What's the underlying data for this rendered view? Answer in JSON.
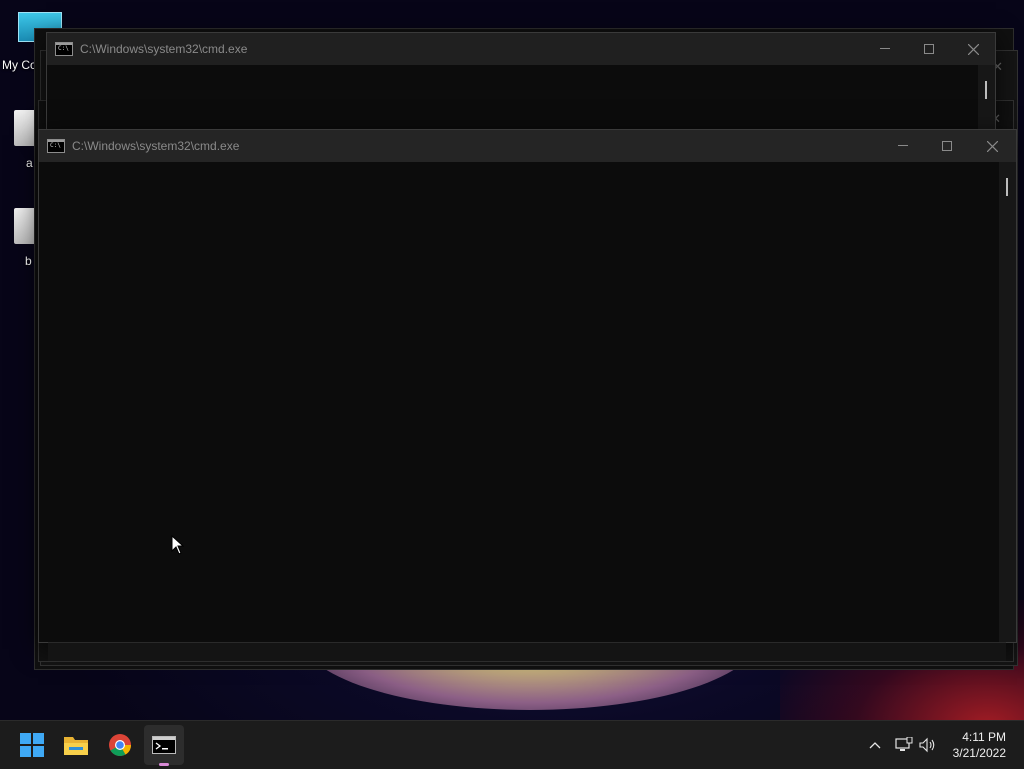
{
  "desktop": {
    "icons": [
      {
        "label": "My Co"
      },
      {
        "label": "a"
      },
      {
        "label": "b"
      }
    ]
  },
  "windows": [
    {
      "title": "C:\\Windows\\system32\\cmd.exe"
    },
    {
      "title": "C:\\Windows\\system32\\cmd.exe"
    }
  ],
  "taskbar": {
    "apps": [
      "start-icon",
      "file-explorer-icon",
      "chrome-icon",
      "command-prompt-icon"
    ]
  },
  "tray": {
    "time": "4:11 PM",
    "date": "3/21/2022"
  }
}
